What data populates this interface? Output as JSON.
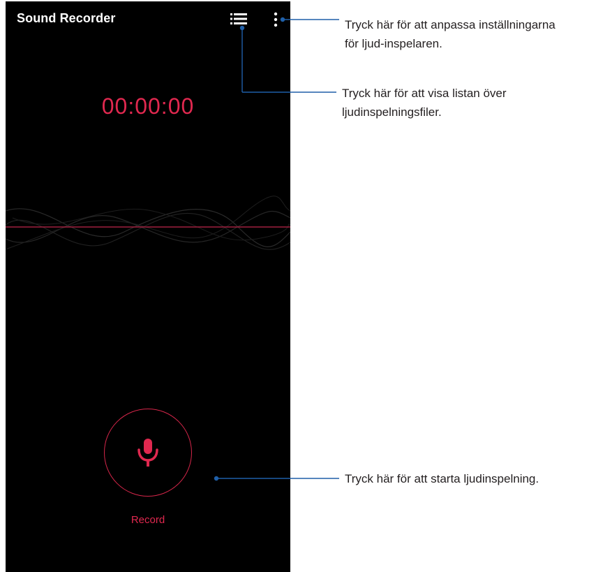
{
  "app": {
    "title": "Sound Recorder",
    "background_color": "#000000",
    "accent_color": "#e0284f"
  },
  "toolbar": {
    "list_icon": "list-icon",
    "menu_icon": "more-vertical-icon"
  },
  "recorder": {
    "timer": "00:00:00",
    "record_label": "Record",
    "record_icon": "microphone-icon"
  },
  "annotations": {
    "callout_color": "#1f5fa8",
    "settings": {
      "line1": "Tryck här för att anpassa inställningarna",
      "line2": "för ljud-inspelaren."
    },
    "file_list": {
      "line1": "Tryck här för att visa listan över",
      "line2": "ljudinspelningsfiler."
    },
    "record": {
      "line1": "Tryck här för att starta ljudinspelning."
    }
  }
}
